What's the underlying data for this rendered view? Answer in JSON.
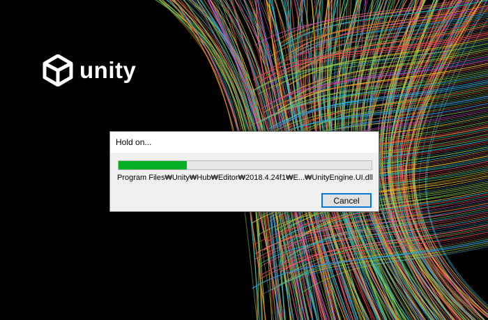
{
  "splash": {
    "brand_text": "unity",
    "logo_icon": "unity-cube-icon",
    "background": "#000000",
    "fiber_colors": [
      "#e0474c",
      "#f0c020",
      "#2ab0a8",
      "#3a8fd0",
      "#7cc24a",
      "#e07a30",
      "#c84cc0",
      "#28c0d8",
      "#f06080",
      "#88d050"
    ]
  },
  "dialog": {
    "title": "Hold on...",
    "progress_fraction": 0.27,
    "progress_color": "#06b025",
    "path_text": "Program Files₩Unity₩Hub₩Editor₩2018.4.24f1₩E...₩UnityEngine.UI.dll",
    "cancel_label": "Cancel"
  }
}
